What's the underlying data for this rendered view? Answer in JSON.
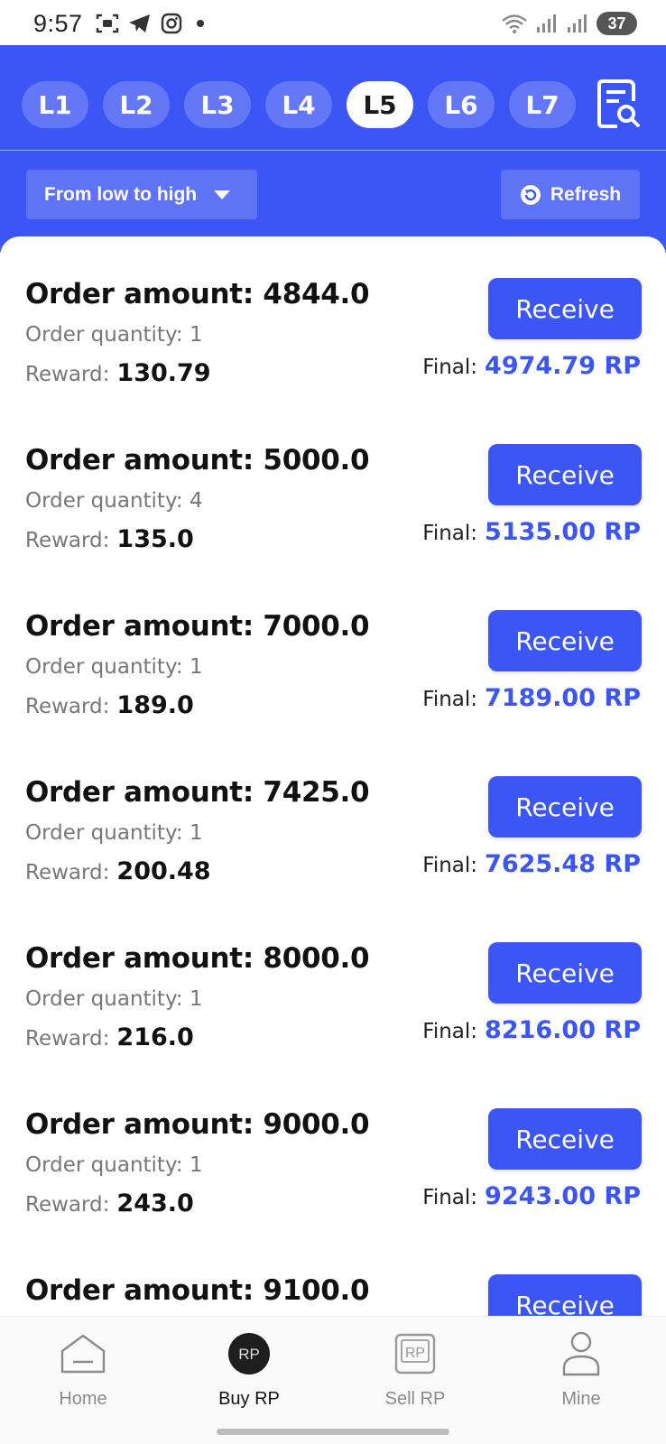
{
  "status_bar": {
    "time": "9:57",
    "battery": "37"
  },
  "levels": {
    "tabs": [
      "L1",
      "L2",
      "L3",
      "L4",
      "L5",
      "L6",
      "L7"
    ],
    "active": "L5"
  },
  "toolbar": {
    "sort_label": "From low to high",
    "refresh_label": "Refresh"
  },
  "labels": {
    "order_amount": "Order amount:",
    "order_quantity": "Order quantity:",
    "reward": "Reward:",
    "final": "Final:",
    "receive": "Receive"
  },
  "orders": [
    {
      "amount": "4844.0",
      "quantity": "1",
      "reward": "130.79",
      "final": "4974.79 RP"
    },
    {
      "amount": "5000.0",
      "quantity": "4",
      "reward": "135.0",
      "final": "5135.00 RP"
    },
    {
      "amount": "7000.0",
      "quantity": "1",
      "reward": "189.0",
      "final": "7189.00 RP"
    },
    {
      "amount": "7425.0",
      "quantity": "1",
      "reward": "200.48",
      "final": "7625.48 RP"
    },
    {
      "amount": "8000.0",
      "quantity": "1",
      "reward": "216.0",
      "final": "8216.00 RP"
    },
    {
      "amount": "9000.0",
      "quantity": "1",
      "reward": "243.0",
      "final": "9243.00 RP"
    },
    {
      "amount": "9100.0",
      "quantity": "",
      "reward": "",
      "final": ""
    }
  ],
  "bottom_nav": [
    {
      "label": "Home",
      "icon": "home-icon"
    },
    {
      "label": "Buy RP",
      "icon": "buy-rp-icon"
    },
    {
      "label": "Sell RP",
      "icon": "sell-rp-icon"
    },
    {
      "label": "Mine",
      "icon": "user-icon"
    }
  ],
  "colors": {
    "primary": "#3c55f5",
    "text": "#111111",
    "muted": "#777777"
  }
}
